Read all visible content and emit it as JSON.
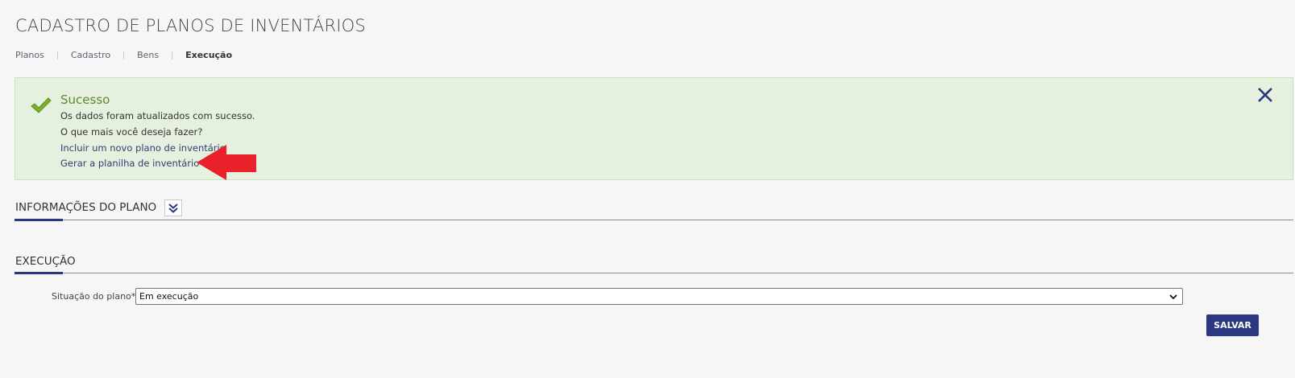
{
  "page": {
    "title": "CADASTRO DE PLANOS DE INVENTÁRIOS"
  },
  "breadcrumb": {
    "items": [
      {
        "label": "Planos"
      },
      {
        "label": "Cadastro"
      },
      {
        "label": "Bens"
      },
      {
        "label": "Execução"
      }
    ]
  },
  "alert": {
    "icon": "check-icon",
    "title": "Sucesso",
    "message": "Os dados foram atualizados com sucesso.",
    "question": "O que mais você deseja fazer?",
    "links": [
      {
        "label": "Incluir um novo plano de inventário"
      },
      {
        "label": "Gerar a planilha de inventário"
      }
    ],
    "close_icon": "close-icon",
    "colors": {
      "background": "#e6f0de",
      "title": "#5c8a2e",
      "link": "#2f3e74",
      "annotation_arrow": "#e8212b"
    }
  },
  "sections": {
    "info": {
      "title": "INFORMAÇÕES DO PLANO",
      "toggle_icon": "double-chevron-down-icon"
    },
    "execution": {
      "title": "EXECUÇÃO"
    }
  },
  "form": {
    "status_label": "Situação do plano*:",
    "status_value": "Em execução",
    "save_label": "SALVAR"
  },
  "theme": {
    "accent": "#2b3880"
  }
}
